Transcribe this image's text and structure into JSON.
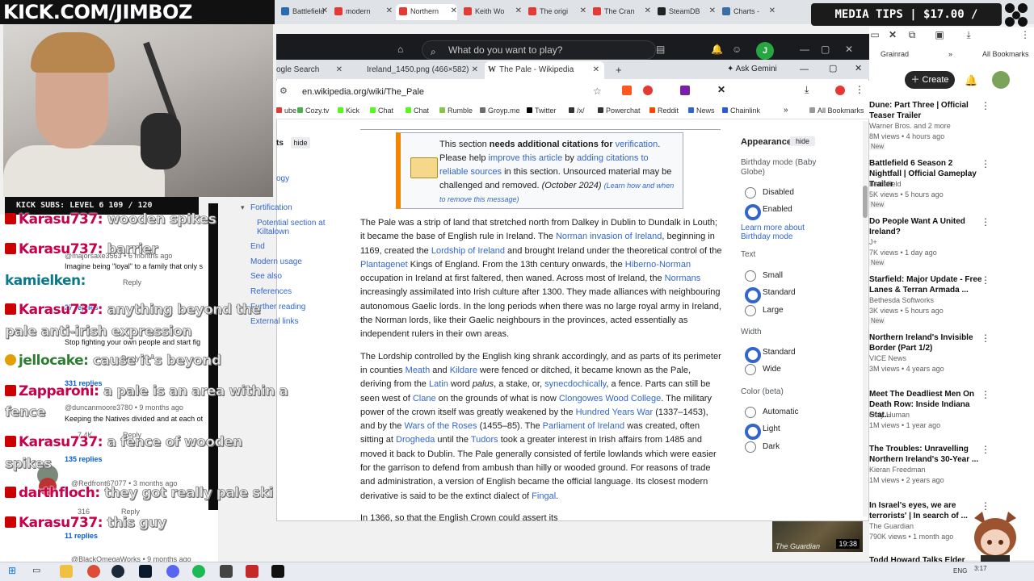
{
  "stream": {
    "channel_url": "KICK.COM/JIMBOZ",
    "media_tips": "MEDIA TIPS | $17.00 / $200.00",
    "kick_subs": "KICK SUBS: LEVEL 6 109 / 120"
  },
  "outer_tabs": [
    {
      "label": "Battlefield",
      "color": "#2b6cb0"
    },
    {
      "label": "modern",
      "color": "#e53935"
    },
    {
      "label": "Northern",
      "color": "#e53935"
    },
    {
      "label": "Keith Wo",
      "color": "#e53935"
    },
    {
      "label": "The origi",
      "color": "#e53935"
    },
    {
      "label": "The Cran",
      "color": "#e53935"
    },
    {
      "label": "SteamDB",
      "color": "#222"
    },
    {
      "label": "Charts -",
      "color": "#3a6ea5"
    }
  ],
  "steam": {
    "search_placeholder": "What do you want to play?",
    "avatar_letter": "J"
  },
  "chrome": {
    "tabs": [
      {
        "label": "ogle Search"
      },
      {
        "label": "Ireland_1450.png (466×582)"
      },
      {
        "label": "The Pale - Wikipedia"
      }
    ],
    "new_tab": "+",
    "gemini": "Ask Gemini",
    "url": "en.wikipedia.org/wiki/The_Pale",
    "bookmarks": [
      {
        "label": "ube",
        "color": "#e53935"
      },
      {
        "label": "Cozy.tv",
        "color": "#4caf50"
      },
      {
        "label": "Kick",
        "color": "#53fc18"
      },
      {
        "label": "Chat",
        "color": "#53fc18"
      },
      {
        "label": "Chat",
        "color": "#53fc18"
      },
      {
        "label": "Rumble",
        "color": "#85c742"
      },
      {
        "label": "Groyp.me",
        "color": "#6d6d6d"
      },
      {
        "label": "Twitter",
        "color": "#000"
      },
      {
        "label": "/x/",
        "color": "#333"
      },
      {
        "label": "Powerchat",
        "color": "#333"
      },
      {
        "label": "Reddit",
        "color": "#ff4500"
      },
      {
        "label": "News",
        "color": "#3366cc"
      },
      {
        "label": "Chainlink",
        "color": "#2a5ada"
      }
    ],
    "all_bookmarks": "All Bookmarks"
  },
  "wiki": {
    "toc_hide": "hide",
    "toc_fragment_1": "ts",
    "toc_fragment_2": "ogy",
    "toc": [
      "Fortification",
      "Potential section at",
      "Kiltalown",
      "End",
      "Modern usage",
      "See also",
      "References",
      "Further reading",
      "External links"
    ],
    "notice": {
      "p1": "This section ",
      "bold": "needs additional citations for ",
      "verification": "verification",
      "p2": ". Please help ",
      "improve": "improve this article",
      "p3": " by ",
      "adding": "adding citations to reliable sources",
      "p4": " in this section. Unsourced material may be challenged and removed. ",
      "date": "(October 2024)",
      "learn": "(Learn how and when to remove this message)"
    },
    "para1": [
      "The Pale was a strip of land that stretched north from Dalkey in Dublin to Dundalk in Louth; it became the base of English rule in Ireland. The ",
      "Norman invasion of Ireland",
      ", beginning in 1169, created the ",
      "Lordship of Ireland",
      " and brought Ireland under the theoretical control of the ",
      "Plantagenet",
      " Kings of England. From the 13th century onwards, the ",
      "Hiberno-Norman",
      " occupation in Ireland at first faltered, then waned. Across most of Ireland, the ",
      "Normans",
      " increasingly assimilated into Irish culture after 1300. They made alliances with neighbouring autonomous Gaelic lords. In the long periods when there was no large royal army in Ireland, the Norman lords, like their Gaelic neighbours in the provinces, acted essentially as independent rulers in their own areas."
    ],
    "para2": [
      "The Lordship controlled by the English king shrank accordingly, and as parts of its perimeter in counties ",
      "Meath",
      " and ",
      "Kildare",
      " were fenced or ditched, it became known as the Pale, deriving from the ",
      "Latin",
      " word ",
      "palus",
      ", a stake, or, ",
      "synecdochically",
      ", a fence. Parts can still be seen west of ",
      "Clane",
      " on the grounds of what is now ",
      "Clongowes Wood College",
      ". The military power of the crown itself was greatly weakened by the ",
      "Hundred Years War",
      " (1337–1453), and by the ",
      "Wars of the Roses",
      " (1455–85). The ",
      "Parliament of Ireland",
      " was created, often sitting at ",
      "Drogheda",
      " until the ",
      "Tudors",
      " took a greater interest in Irish affairs from 1485 and moved it back to Dublin. The Pale generally consisted of fertile lowlands which were easier for the garrison to defend from ambush than hilly or wooded ground. For reasons of trade and administration, a version of English became the official language. Its closest modern derivative is said to be the extinct dialect of ",
      "Fingal",
      "."
    ],
    "para3": "In 1366, so that the English Crown could assert its",
    "appearance": {
      "title": "Appearance",
      "hide": "hide",
      "birthday_mode": "Birthday mode (Baby Globe)",
      "disabled": "Disabled",
      "enabled": "Enabled",
      "learn_more": "Learn more about Birthday mode",
      "text": "Text",
      "small": "Small",
      "standard": "Standard",
      "large": "Large",
      "width": "Width",
      "width_standard": "Standard",
      "wide": "Wide",
      "color": "Color (beta)",
      "automatic": "Automatic",
      "light": "Light",
      "dark": "Dark"
    }
  },
  "youtube_panel": {
    "grainrad": "Grainrad",
    "all_bookmarks": "All Bookmarks",
    "create": "Create",
    "videos": [
      {
        "title": "Dune: Part Three | Official Teaser Trailer",
        "channel": "Warner Bros. and 2 more",
        "stats": "8M views • 4 hours ago",
        "badge": "New"
      },
      {
        "title": "Battlefield 6 Season 2 Nightfall | Official Gameplay Trailer",
        "channel": "Battlefield",
        "stats": "5K views • 5 hours ago",
        "badge": "New"
      },
      {
        "title": "Do People Want A United Ireland?",
        "channel": "J+",
        "stats": "7K views • 1 day ago",
        "badge": "New"
      },
      {
        "title": "Starfield: Major Update - Free Lanes & Terran Armada ...",
        "channel": "Bethesda Softworks",
        "stats": "3K views • 5 hours ago",
        "badge": "New"
      },
      {
        "title": "Northern Ireland's Invisible Border (Part 1/2)",
        "channel": "VICE News",
        "stats": "3M views • 4 years ago",
        "badge": ""
      },
      {
        "title": "Meet The Deadliest Men On Death Row: Inside Indiana Stat...",
        "channel": "Only Human",
        "stats": "1M views • 1 year ago",
        "badge": ""
      },
      {
        "title": "The Troubles: Unravelling Northern Ireland's 30-Year ...",
        "channel": "Kieran Freedman",
        "stats": "1M views • 2 years ago",
        "badge": ""
      },
      {
        "title": "In Israel's eyes, we are terrorists' | In search of ...",
        "channel": "The Guardian",
        "stats": "790K views • 1 month ago",
        "badge": ""
      },
      {
        "title": "Todd Howard Talks Elder Scrolls...",
        "channel": "",
        "stats": "",
        "badge": ""
      }
    ],
    "thumb_duration": "19:38",
    "thumb_label": "The Guardian"
  },
  "yt_comments": [
    {
      "kind": "g",
      "text": "@majorsaxe3563 • 6 months ago"
    },
    {
      "kind": "t",
      "text": "Imagine being \"loyal\" to a family that only s"
    },
    {
      "kind": "g",
      "text": "Reply"
    },
    {
      "kind": "b",
      "text": "27 replies"
    },
    {
      "kind": "t",
      "text": "Stop fighting your own people and start fig"
    },
    {
      "kind": "g",
      "text": "Reply"
    },
    {
      "kind": "b",
      "text": "331 replies"
    },
    {
      "kind": "g",
      "text": "@duncanmoore3780 • 9 months ago"
    },
    {
      "kind": "t",
      "text": "Keeping the Natives divided and at each ot"
    },
    {
      "kind": "g",
      "text": "7.4K"
    },
    {
      "kind": "g",
      "text": "Reply"
    },
    {
      "kind": "b",
      "text": "135 replies"
    },
    {
      "kind": "g",
      "text": "@Redfront67077 • 3 months ago"
    },
    {
      "kind": "g",
      "text": "316"
    },
    {
      "kind": "g",
      "text": "Reply"
    },
    {
      "kind": "b",
      "text": "11 replies"
    },
    {
      "kind": "g",
      "text": "@BlackOmegaWorks • 9 months ago"
    }
  ],
  "chat": [
    {
      "user": "Karasu737:",
      "msg": "wooden spikes",
      "color": "r"
    },
    {
      "user": "Karasu737:",
      "msg": "barrier",
      "color": "r"
    },
    {
      "user": "kamielken:",
      "msg": "",
      "color": "t"
    },
    {
      "user": "Karasu737:",
      "msg": "anything beyond the",
      "color": "r"
    },
    {
      "user": "",
      "msg": "pale anti-irish expression",
      "color": "r"
    },
    {
      "user": "jellocake:",
      "msg": "cause it's beyond",
      "color": "g"
    },
    {
      "user": "Zapparoni:",
      "msg": "a pale is an area within a",
      "color": "r"
    },
    {
      "user": "",
      "msg": "fence",
      "color": "r"
    },
    {
      "user": "Karasu737:",
      "msg": "a fence of wooden",
      "color": "r"
    },
    {
      "user": "",
      "msg": "spikes",
      "color": "r"
    },
    {
      "user": "darthfloch:",
      "msg": "they got really pale ski",
      "color": "r"
    },
    {
      "user": "Karasu737:",
      "msg": "this guy",
      "color": "r"
    }
  ],
  "taskbar": {
    "lang": "ENG",
    "time": "3:17"
  }
}
